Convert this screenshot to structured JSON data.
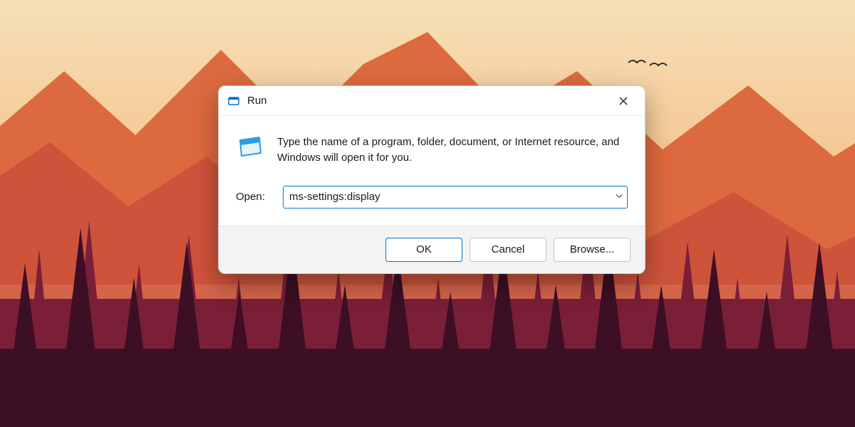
{
  "dialog": {
    "title": "Run",
    "description": "Type the name of a program, folder, document, or Internet resource, and Windows will open it for you.",
    "open_label": "Open:",
    "open_value": "ms-settings:display",
    "buttons": {
      "ok": "OK",
      "cancel": "Cancel",
      "browse": "Browse..."
    }
  }
}
